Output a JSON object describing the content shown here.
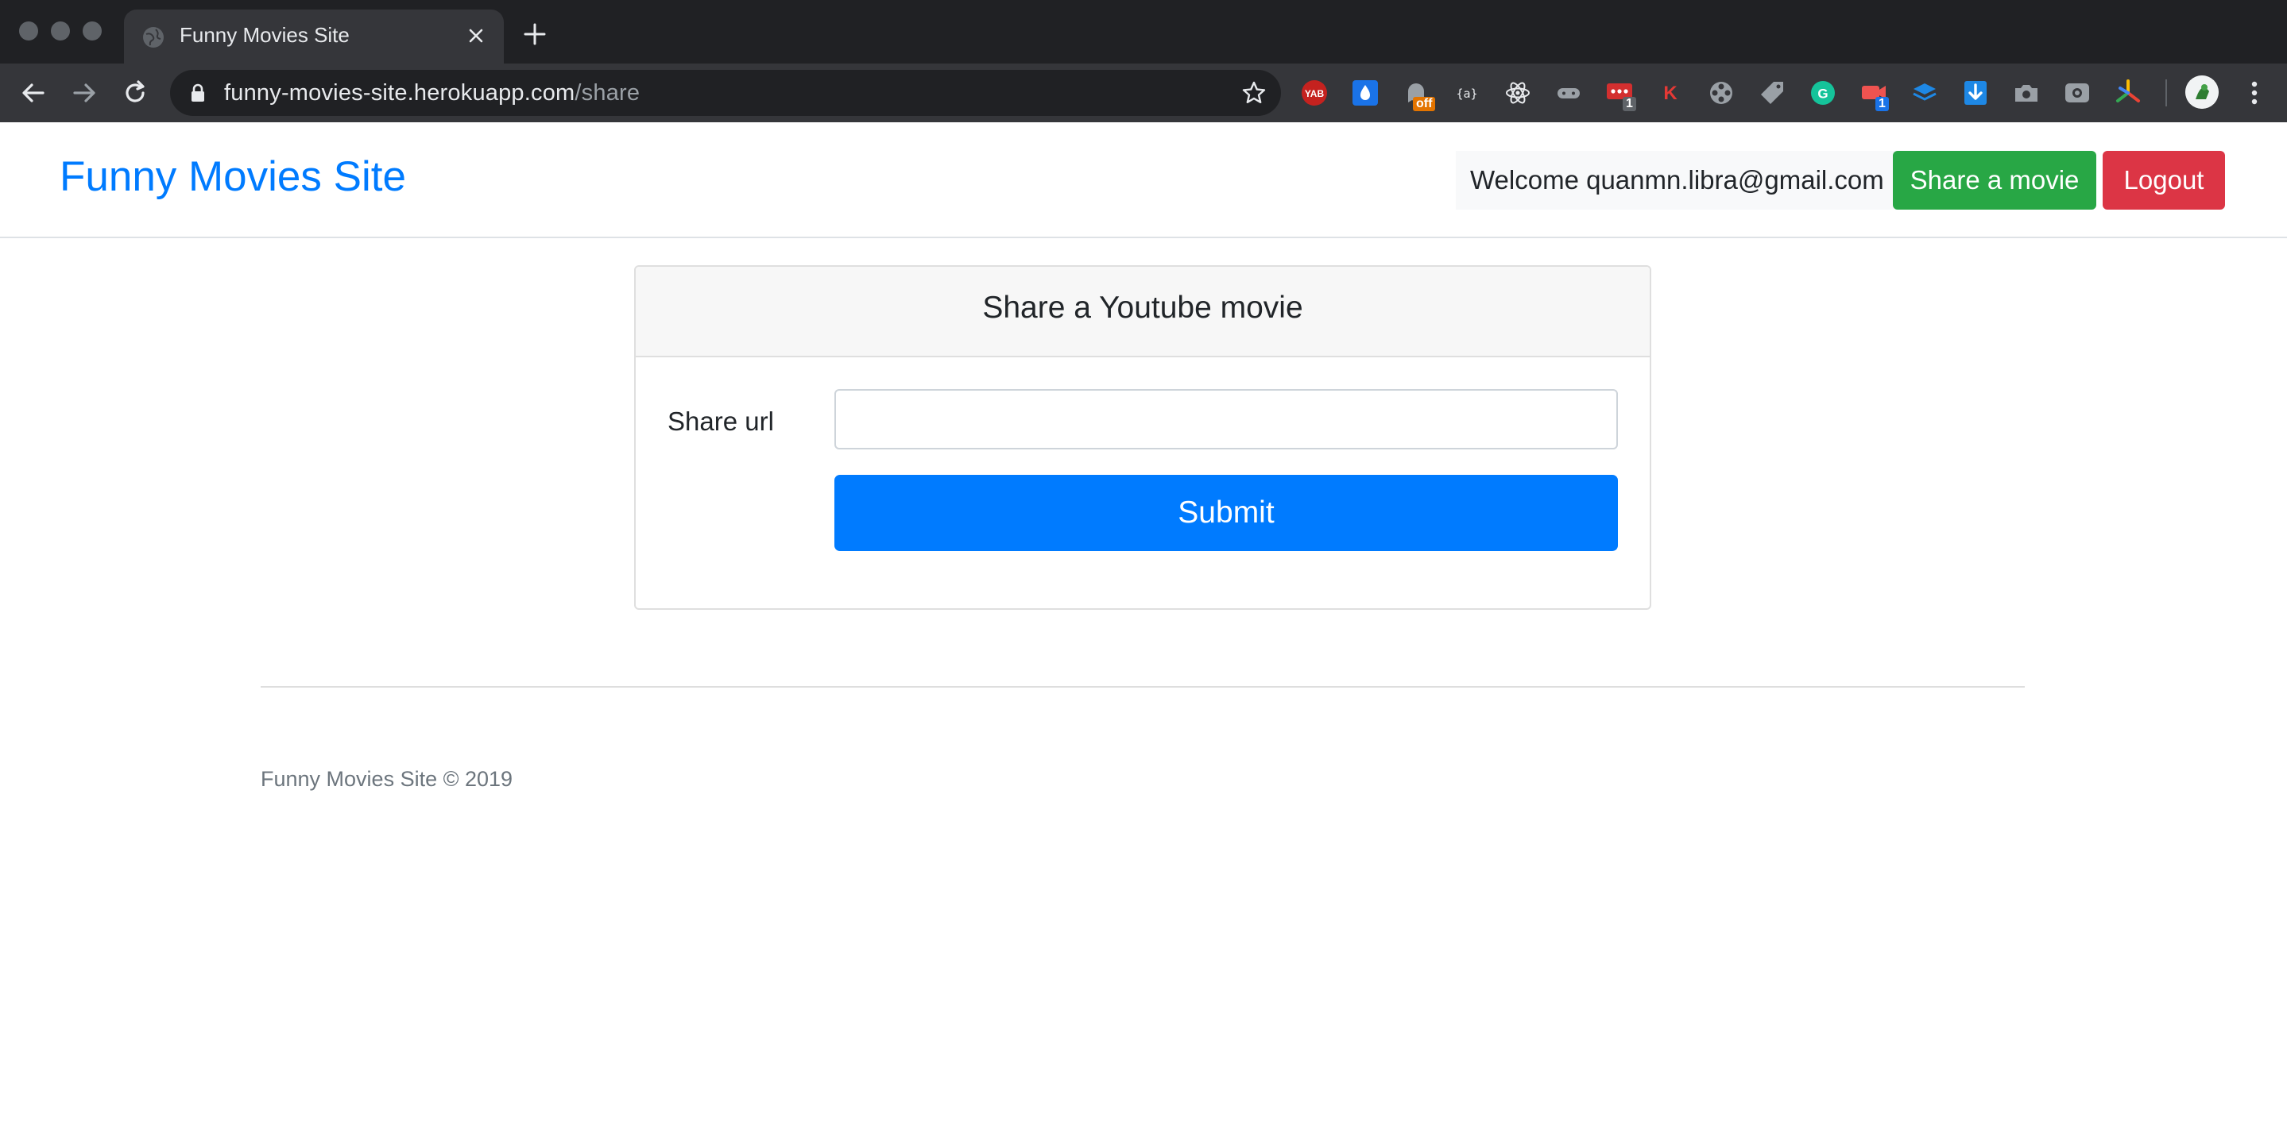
{
  "browser": {
    "tab": {
      "title": "Funny Movies Site"
    },
    "address_bar": {
      "host": "funny-movies-site.herokuapp.com",
      "path": "/share"
    },
    "extensions": [
      {
        "icon": "yab-icon",
        "label": "YAB",
        "color": "#c5221f"
      },
      {
        "icon": "water-drop-icon",
        "color": "#1a73e8"
      },
      {
        "icon": "ghost-icon",
        "badge": "off",
        "badge_color": "#e37400"
      },
      {
        "icon": "json-viewer-icon",
        "label": "{a}"
      },
      {
        "icon": "react-icon"
      },
      {
        "icon": "gamepad-icon"
      },
      {
        "icon": "lastpass-icon",
        "badge": "1",
        "badge_color": "#5f6368",
        "color": "#d32f2f"
      },
      {
        "icon": "k-icon",
        "label": "K",
        "color": "#e53935"
      },
      {
        "icon": "film-reel-icon"
      },
      {
        "icon": "tag-icon"
      },
      {
        "icon": "grammarly-icon",
        "label": "G",
        "color": "#15c39a"
      },
      {
        "icon": "video-badge-icon",
        "badge": "1",
        "badge_color": "#1a73e8"
      },
      {
        "icon": "layers-icon",
        "color": "#1e88e5"
      },
      {
        "icon": "download-icon",
        "color": "#1e88e5"
      },
      {
        "icon": "camera-icon"
      },
      {
        "icon": "screen-record-icon"
      },
      {
        "icon": "pinwheel-icon"
      }
    ]
  },
  "navbar": {
    "brand": "Funny Movies Site",
    "welcome": "Welcome quanmn.libra@gmail.com",
    "share_button": "Share a movie",
    "logout_button": "Logout"
  },
  "share_card": {
    "title": "Share a Youtube movie",
    "url_label": "Share url",
    "url_value": "",
    "url_placeholder": "",
    "submit_button": "Submit"
  },
  "footer": {
    "text": "Funny Movies Site © 2019"
  },
  "colors": {
    "brand_blue": "#007bff",
    "success_green": "#28a745",
    "danger_red": "#dc3545"
  }
}
